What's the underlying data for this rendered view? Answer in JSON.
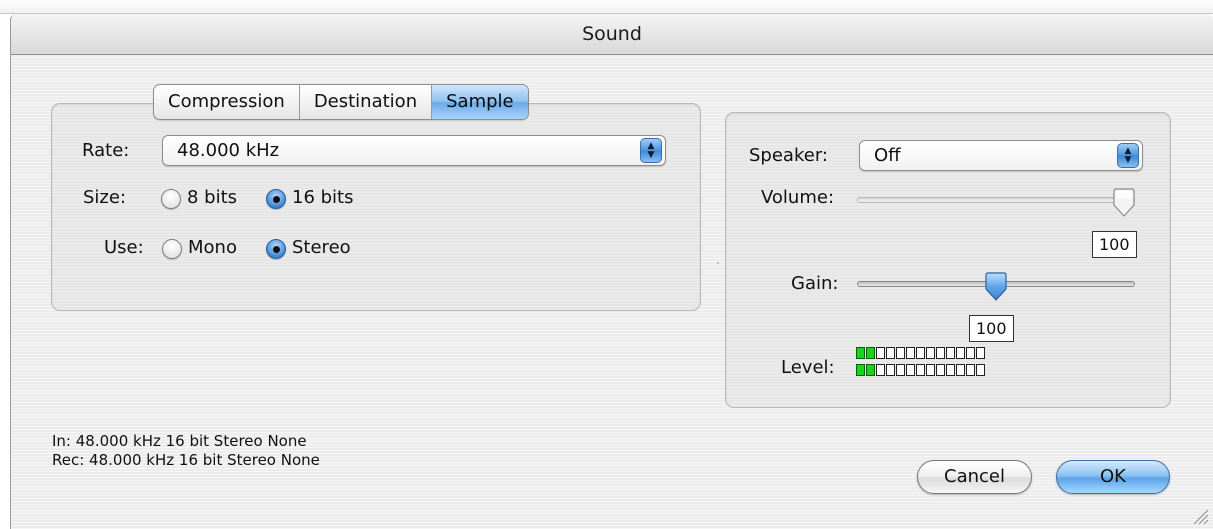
{
  "window": {
    "title": "Sound"
  },
  "tabs": [
    {
      "label": "Compression",
      "selected": false
    },
    {
      "label": "Destination",
      "selected": false
    },
    {
      "label": "Sample",
      "selected": true
    }
  ],
  "sample": {
    "rate_label": "Rate:",
    "rate_value": "48.000 kHz",
    "size_label": "Size:",
    "size_options": [
      {
        "label": "8 bits",
        "selected": false
      },
      {
        "label": "16 bits",
        "selected": true
      }
    ],
    "use_label": "Use:",
    "use_options": [
      {
        "label": "Mono",
        "selected": false
      },
      {
        "label": "Stereo",
        "selected": true
      }
    ]
  },
  "output": {
    "speaker_label": "Speaker:",
    "speaker_value": "Off",
    "volume_label": "Volume:",
    "volume_value": "100",
    "volume_level": 1.0,
    "gain_label": "Gain:",
    "gain_value": "100",
    "gain_level": 0.5,
    "level_label": "Level:",
    "level_channels": [
      {
        "lit": 2,
        "total": 13
      },
      {
        "lit": 2,
        "total": 13
      }
    ]
  },
  "status": {
    "in": "In: 48.000 kHz 16 bit Stereo None",
    "rec": "Rec: 48.000 kHz 16 bit Stereo None"
  },
  "buttons": {
    "cancel": "Cancel",
    "ok": "OK"
  },
  "colors": {
    "accent_blue": "#5ba4e9",
    "meter_green": "#17d51a"
  }
}
